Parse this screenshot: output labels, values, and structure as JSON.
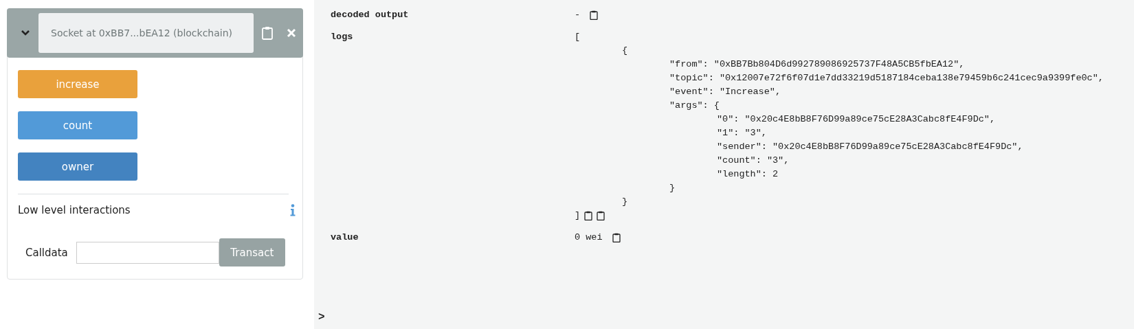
{
  "instance": {
    "title": "Socket at 0xBB7...bEA12 (blockchain)",
    "expanded": true
  },
  "functions": [
    {
      "label": "increase",
      "kind": "transact"
    },
    {
      "label": "count",
      "kind": "call"
    },
    {
      "label": "owner",
      "kind": "call-hover"
    }
  ],
  "low_level": {
    "title": "Low level interactions",
    "calldata_label": "Calldata",
    "button": "Transact"
  },
  "output": {
    "rows": [
      {
        "label": "decoded output",
        "kind": "text",
        "value": "-",
        "actions": [
          {
            "kind": "copy"
          }
        ]
      },
      {
        "label": "logs",
        "kind": "tree",
        "tree": {
          "open": "[",
          "close": "]",
          "children": [
            {
              "open": "{",
              "close": "}",
              "children": [
                {
                  "text": "\"from\": \"0xBB7Bb804D6d992789086925737F48A5CB5fbEA12\","
                },
                {
                  "text": "\"topic\": \"0x12007e72f6f07d1e7dd33219d5187184ceba138e79459b6c241cec9a9399fe0c\","
                },
                {
                  "text": "\"event\": \"Increase\","
                },
                {
                  "open": "\"args\": {",
                  "close": "}",
                  "children": [
                    {
                      "text": "\"0\": \"0x20c4E8bB8F76D99a89ce75cE28A3Cabc8fE4F9Dc\","
                    },
                    {
                      "text": "\"1\": \"3\","
                    },
                    {
                      "text": "\"sender\": \"0x20c4E8bB8F76D99a89ce75cE28A3Cabc8fE4F9Dc\","
                    },
                    {
                      "text": "\"count\": \"3\","
                    },
                    {
                      "text": "\"length\": 2"
                    }
                  ]
                }
              ]
            }
          ]
        },
        "actions": [
          {
            "kind": "copy"
          },
          {
            "kind": "copy"
          }
        ]
      },
      {
        "label": "value",
        "kind": "text",
        "value": "0 wei",
        "actions": [
          {
            "kind": "copy"
          }
        ]
      }
    ]
  },
  "prompt": ">"
}
